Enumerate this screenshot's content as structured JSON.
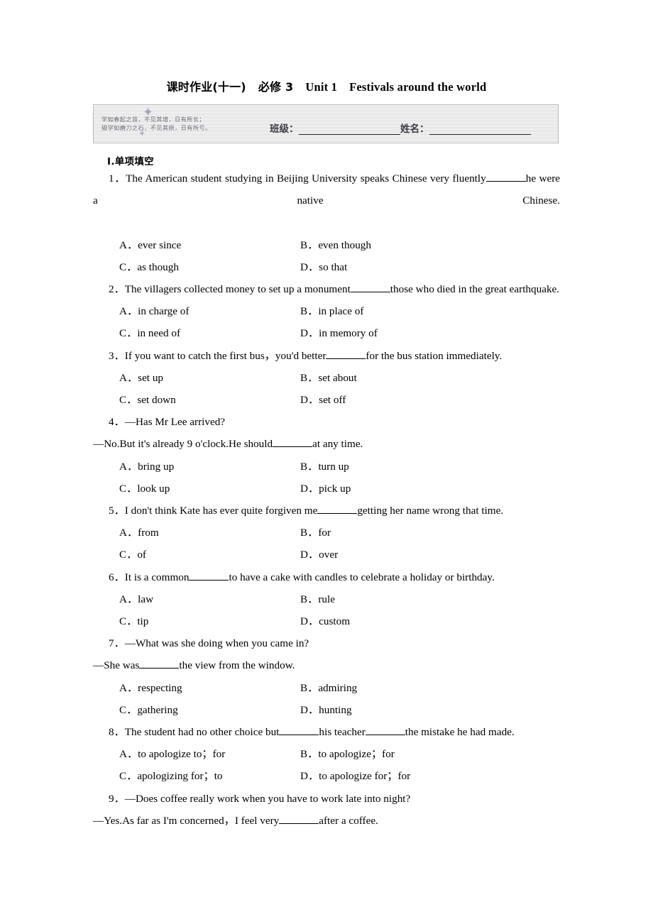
{
  "title": {
    "cn_part": "课时作业(十一)",
    "book": "必修 3",
    "unit": "Unit 1",
    "topic": "Festivals around the world"
  },
  "header_box": {
    "motto_line1": "学如春起之苗，不见其增，日有所长；",
    "motto_line2": "辍学如磨刀之石，不见其损，日有所亏。",
    "class_label": "班级：",
    "name_label": "姓名："
  },
  "section": {
    "heading": "Ⅰ.单项填空"
  },
  "questions": [
    {
      "number": "1．",
      "stem_before": "The American student studying in Beijing University speaks Chinese very fluently",
      "stem_after": "he were a native Chinese.",
      "options": {
        "A": "A．ever since",
        "B": "B．even though",
        "C": "C．as though",
        "D": "D．so that"
      }
    },
    {
      "number": "2．",
      "stem_before": "The villagers collected money to set up a monument",
      "stem_after": "those who died in the great earthquake.",
      "options": {
        "A": "A．in charge of",
        "B": "B．in place of",
        "C": "C．in need of",
        "D": "D．in memory of"
      }
    },
    {
      "number": "3．",
      "stem_before": "If you want to catch the first bus，you'd better",
      "stem_after": "for the bus station immediately.",
      "options": {
        "A": "A．set up",
        "B": "B．set about",
        "C": "C．set down",
        "D": "D．set off"
      }
    },
    {
      "number": "4．",
      "dialog_line1": "—Has Mr Lee arrived?",
      "dialog_before": "—No.But it's already 9 o'clock.He should",
      "dialog_after": "at any time.",
      "options": {
        "A": "A．bring up",
        "B": "B．turn up",
        "C": "C．look up",
        "D": "D．pick up"
      }
    },
    {
      "number": "5．",
      "stem_before": "I don't think Kate has ever quite forgiven me",
      "stem_after": "getting her name wrong that time.",
      "options": {
        "A": "A．from",
        "B": "B．for",
        "C": "C．of",
        "D": "D．over"
      }
    },
    {
      "number": "6．",
      "stem_before": "It is a common",
      "stem_after": "to have a cake with candles to celebrate a holiday or birthday.",
      "options": {
        "A": "A．law",
        "B": "B．rule",
        "C": "C．tip",
        "D": "D．custom"
      }
    },
    {
      "number": "7．",
      "dialog_line1": "—What was she doing when you came in?",
      "dialog_before": "—She was",
      "dialog_after": "the view from the window.",
      "options": {
        "A": "A．respecting",
        "B": "B．admiring",
        "C": "C．gathering",
        "D": "D．hunting"
      }
    },
    {
      "number": "8．",
      "stem_before": "The student had no other choice but",
      "stem_mid": "his teacher",
      "stem_after": "the mistake he had made.",
      "options": {
        "A": "A．to apologize to；for",
        "B": "B．to apologize；for",
        "C": "C．apologizing for；to",
        "D": "D．to apologize for；for"
      }
    },
    {
      "number": "9．",
      "dialog_line1": "—Does coffee really work when you have to work late into night?",
      "dialog_before": "—Yes.As far as I'm concerned，I feel very",
      "dialog_after": "after a coffee."
    }
  ]
}
